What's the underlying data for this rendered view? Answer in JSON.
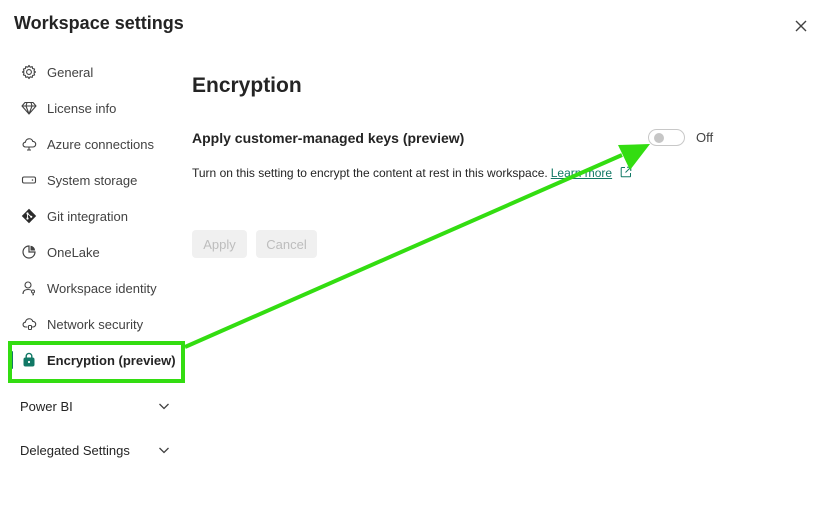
{
  "dialog": {
    "title": "Workspace settings",
    "close_icon": "close-icon"
  },
  "sidebar": {
    "items": [
      {
        "label": "General",
        "icon": "gear-icon"
      },
      {
        "label": "License info",
        "icon": "diamond-icon"
      },
      {
        "label": "Azure connections",
        "icon": "cloud-icon"
      },
      {
        "label": "System storage",
        "icon": "storage-icon"
      },
      {
        "label": "Git integration",
        "icon": "git-icon"
      },
      {
        "label": "OneLake",
        "icon": "onelake-icon"
      },
      {
        "label": "Workspace identity",
        "icon": "identity-icon"
      },
      {
        "label": "Network security",
        "icon": "network-cloud-icon"
      },
      {
        "label": "Encryption (preview)",
        "icon": "lock-bag-icon",
        "active": true
      }
    ],
    "sections": [
      {
        "label": "Power BI",
        "icon": "chevron-down-icon"
      },
      {
        "label": "Delegated Settings",
        "icon": "chevron-down-icon"
      }
    ]
  },
  "main": {
    "title": "Encryption",
    "setting_label": "Apply customer-managed keys (preview)",
    "toggle_state": "Off",
    "description": "Turn on this setting to encrypt the content at rest in this workspace.",
    "learn_more": "Learn more",
    "apply_label": "Apply",
    "cancel_label": "Cancel"
  },
  "colors": {
    "accent": "#117865",
    "annotation": "#33dd11",
    "disabled_text": "#bdbdbd"
  }
}
